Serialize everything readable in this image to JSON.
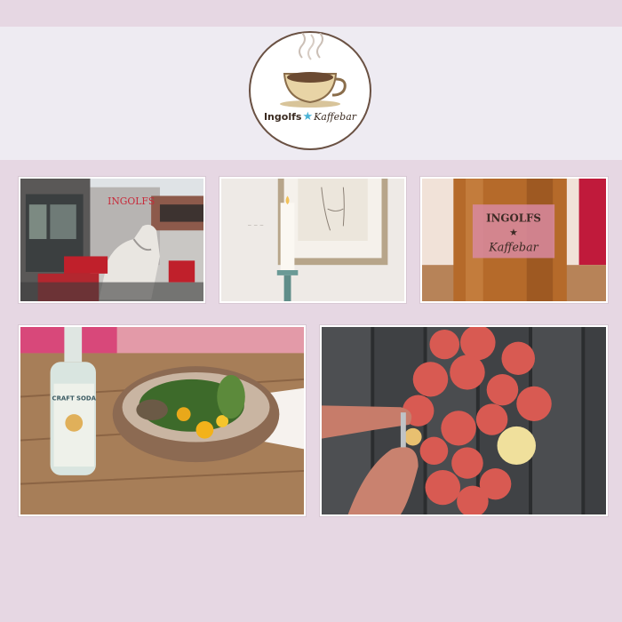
{
  "brand": {
    "name_bold": "Ingolfs",
    "name_star": "★",
    "name_script": "Kaffebar"
  },
  "photos": [
    {
      "caption": "Cafe exterior with carousel horse",
      "sign_text": "INGOLFS"
    },
    {
      "caption": "Candle and framed sketch on wall"
    },
    {
      "caption": "Wooden cylinder with logo label",
      "label_line1": "INGOLFS",
      "label_star": "★",
      "label_line2": "Kaffebar"
    },
    {
      "caption": "Salad bowl with craft soda bottle",
      "bottle_label": "CRAFT SODA"
    },
    {
      "caption": "Hands peeling beets on wooden table"
    }
  ],
  "colors": {
    "page_bg": "#e6d7e3",
    "header_bg": "#eeebf2",
    "accent_star": "#4ab3d6",
    "logo_brown": "#6a5143"
  }
}
